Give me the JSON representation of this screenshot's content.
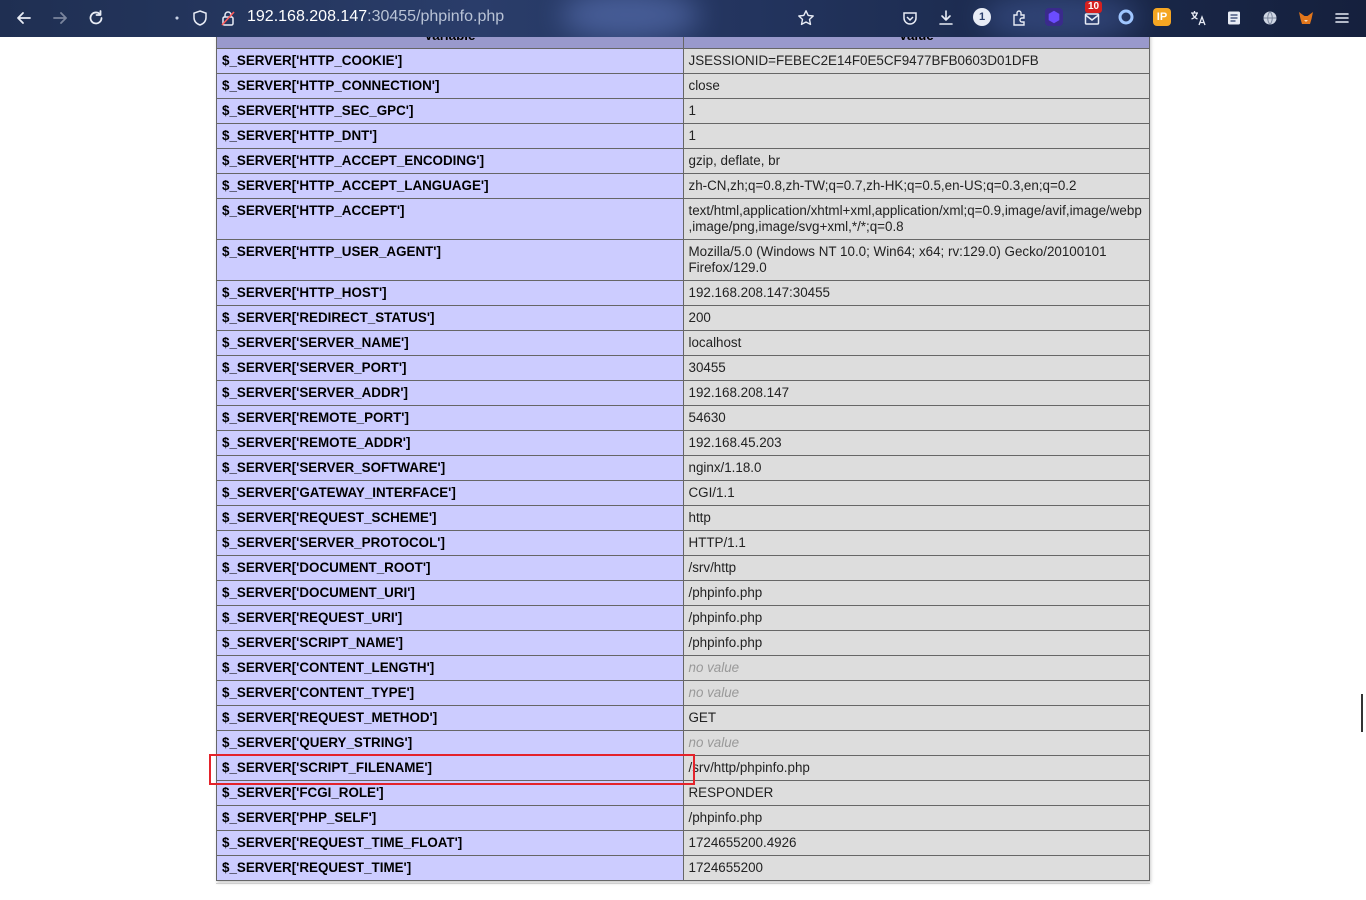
{
  "browser": {
    "url_host": "192.168.208.147",
    "url_rest": ":30455/phpinfo.php",
    "mail_badge": "10",
    "ext_badge": "1",
    "ext_ip_label": "IP"
  },
  "table": {
    "header": {
      "variable": "Variable",
      "value": "Value"
    },
    "rows": [
      {
        "name": "$_SERVER['HTTP_COOKIE']",
        "value": "JSESSIONID=FEBEC2E14F0E5CF9477BFB0603D01DFB"
      },
      {
        "name": "$_SERVER['HTTP_CONNECTION']",
        "value": "close"
      },
      {
        "name": "$_SERVER['HTTP_SEC_GPC']",
        "value": "1"
      },
      {
        "name": "$_SERVER['HTTP_DNT']",
        "value": "1"
      },
      {
        "name": "$_SERVER['HTTP_ACCEPT_ENCODING']",
        "value": "gzip, deflate, br"
      },
      {
        "name": "$_SERVER['HTTP_ACCEPT_LANGUAGE']",
        "value": "zh-CN,zh;q=0.8,zh-TW;q=0.7,zh-HK;q=0.5,en-US;q=0.3,en;q=0.2"
      },
      {
        "name": "$_SERVER['HTTP_ACCEPT']",
        "value": "text/html,application/xhtml+xml,application/xml;q=0.9,image/avif,image/webp,image/png,image/svg+xml,*/*;q=0.8"
      },
      {
        "name": "$_SERVER['HTTP_USER_AGENT']",
        "value": "Mozilla/5.0 (Windows NT 10.0; Win64; x64; rv:129.0) Gecko/20100101 Firefox/129.0"
      },
      {
        "name": "$_SERVER['HTTP_HOST']",
        "value": "192.168.208.147:30455"
      },
      {
        "name": "$_SERVER['REDIRECT_STATUS']",
        "value": "200"
      },
      {
        "name": "$_SERVER['SERVER_NAME']",
        "value": "localhost"
      },
      {
        "name": "$_SERVER['SERVER_PORT']",
        "value": "30455"
      },
      {
        "name": "$_SERVER['SERVER_ADDR']",
        "value": "192.168.208.147"
      },
      {
        "name": "$_SERVER['REMOTE_PORT']",
        "value": "54630"
      },
      {
        "name": "$_SERVER['REMOTE_ADDR']",
        "value": "192.168.45.203"
      },
      {
        "name": "$_SERVER['SERVER_SOFTWARE']",
        "value": "nginx/1.18.0"
      },
      {
        "name": "$_SERVER['GATEWAY_INTERFACE']",
        "value": "CGI/1.1"
      },
      {
        "name": "$_SERVER['REQUEST_SCHEME']",
        "value": "http"
      },
      {
        "name": "$_SERVER['SERVER_PROTOCOL']",
        "value": "HTTP/1.1"
      },
      {
        "name": "$_SERVER['DOCUMENT_ROOT']",
        "value": "/srv/http"
      },
      {
        "name": "$_SERVER['DOCUMENT_URI']",
        "value": "/phpinfo.php"
      },
      {
        "name": "$_SERVER['REQUEST_URI']",
        "value": "/phpinfo.php"
      },
      {
        "name": "$_SERVER['SCRIPT_NAME']",
        "value": "/phpinfo.php"
      },
      {
        "name": "$_SERVER['CONTENT_LENGTH']",
        "value": "no value",
        "no_value": true
      },
      {
        "name": "$_SERVER['CONTENT_TYPE']",
        "value": "no value",
        "no_value": true
      },
      {
        "name": "$_SERVER['REQUEST_METHOD']",
        "value": "GET"
      },
      {
        "name": "$_SERVER['QUERY_STRING']",
        "value": "no value",
        "no_value": true
      },
      {
        "name": "$_SERVER['SCRIPT_FILENAME']",
        "value": "/srv/http/phpinfo.php",
        "highlighted": true
      },
      {
        "name": "$_SERVER['FCGI_ROLE']",
        "value": "RESPONDER"
      },
      {
        "name": "$_SERVER['PHP_SELF']",
        "value": "/phpinfo.php"
      },
      {
        "name": "$_SERVER['REQUEST_TIME_FLOAT']",
        "value": "1724655200.4926"
      },
      {
        "name": "$_SERVER['REQUEST_TIME']",
        "value": "1724655200"
      }
    ]
  },
  "colors": {
    "header_bg": "#9999cc",
    "name_cell_bg": "#ccccff",
    "value_cell_bg": "#dddddd",
    "highlight_border": "#e4232b"
  }
}
